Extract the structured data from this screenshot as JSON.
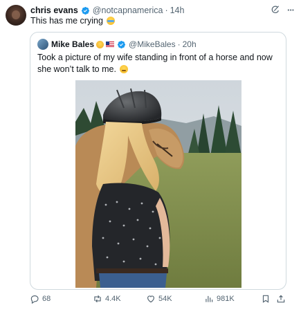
{
  "post": {
    "author_name": "chris evans",
    "handle": "@notcapnamerica",
    "separator": "·",
    "time": "14h",
    "text": "This has me crying",
    "text_emoji": "loudly-crying-face"
  },
  "quoted": {
    "author_name": "Mike Bales",
    "handle": "@MikeBales",
    "separator": "·",
    "time": "20h",
    "text": "Took a picture of my wife standing in front of a horse and now she won’t talk to me.",
    "text_emoji": "pensive-face",
    "image_description_icon": "photo-wife-horse"
  },
  "actions": {
    "replies": "68",
    "reposts": "4.4K",
    "likes": "54K",
    "views": "981K"
  },
  "colors": {
    "verified": "#1d9bf0",
    "muted": "#536471",
    "border": "#cfd9de"
  }
}
